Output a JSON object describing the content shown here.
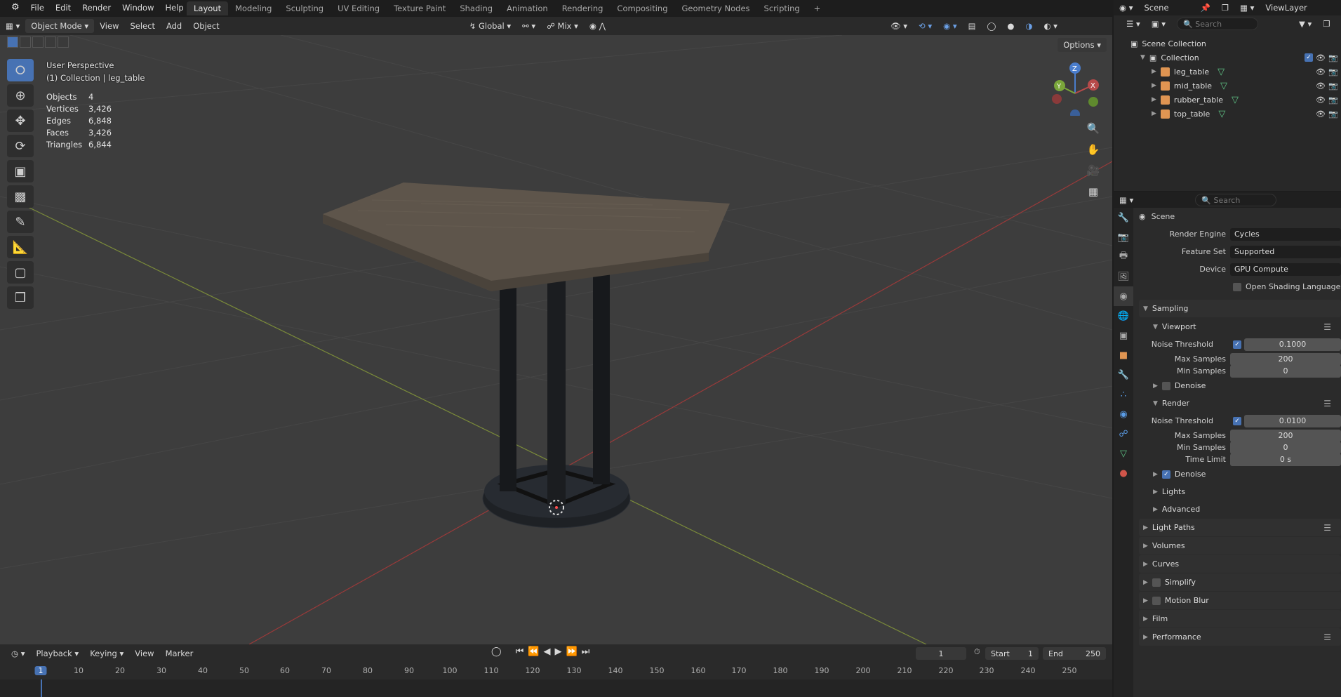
{
  "menu": {
    "app_icon": "blender-icon",
    "items": [
      "File",
      "Edit",
      "Render",
      "Window",
      "Help"
    ]
  },
  "workspaces": {
    "tabs": [
      "Layout",
      "Modeling",
      "Sculpting",
      "UV Editing",
      "Texture Paint",
      "Shading",
      "Animation",
      "Rendering",
      "Compositing",
      "Geometry Nodes",
      "Scripting"
    ],
    "active": "Layout",
    "add": "+"
  },
  "top_right": {
    "scene": "Scene",
    "view_layer": "ViewLayer"
  },
  "viewport_header": {
    "mode": "Object Mode",
    "menus": [
      "View",
      "Select",
      "Add",
      "Object"
    ],
    "orientation": "Global",
    "snap": "Mix",
    "options": "Options"
  },
  "viewport": {
    "perspective": "User Perspective",
    "collection_info": "(1) Collection | leg_table",
    "stats": [
      {
        "label": "Objects",
        "value": "4"
      },
      {
        "label": "Vertices",
        "value": "3,426"
      },
      {
        "label": "Edges",
        "value": "6,848"
      },
      {
        "label": "Faces",
        "value": "3,426"
      },
      {
        "label": "Triangles",
        "value": "6,844"
      }
    ],
    "gizmo_axes": {
      "x": "X",
      "y": "Y",
      "z": "Z"
    }
  },
  "outliner": {
    "search_placeholder": "Search",
    "scene_collection": "Scene Collection",
    "collection": "Collection",
    "objects": [
      "leg_table",
      "mid_table",
      "rubber_table",
      "top_table"
    ]
  },
  "properties": {
    "search_placeholder": "Search",
    "context": "Scene",
    "render_engine_label": "Render Engine",
    "render_engine": "Cycles",
    "feature_set_label": "Feature Set",
    "feature_set": "Supported",
    "device_label": "Device",
    "device": "GPU Compute",
    "osl_label": "Open Shading Language",
    "sampling": "Sampling",
    "viewport": "Viewport",
    "noise_threshold_label": "Noise Threshold",
    "viewport_noise": "0.1000",
    "max_samples_label": "Max Samples",
    "viewport_max": "200",
    "min_samples_label": "Min Samples",
    "viewport_min": "0",
    "denoise": "Denoise",
    "render": "Render",
    "render_noise": "0.0100",
    "render_max": "200",
    "render_min": "0",
    "time_limit_label": "Time Limit",
    "time_limit": "0 s",
    "lights": "Lights",
    "advanced": "Advanced",
    "panels": [
      "Light Paths",
      "Volumes",
      "Curves",
      "Simplify",
      "Motion Blur",
      "Film",
      "Performance"
    ]
  },
  "timeline": {
    "menus": [
      "Playback",
      "Keying",
      "View",
      "Marker"
    ],
    "current_frame": "1",
    "start_label": "Start",
    "start": "1",
    "end_label": "End",
    "end": "250",
    "ruler": [
      "1",
      "10",
      "20",
      "30",
      "40",
      "50",
      "60",
      "70",
      "80",
      "90",
      "100",
      "110",
      "120",
      "130",
      "140",
      "150",
      "160",
      "170",
      "180",
      "190",
      "200",
      "210",
      "220",
      "230",
      "240",
      "250"
    ]
  }
}
